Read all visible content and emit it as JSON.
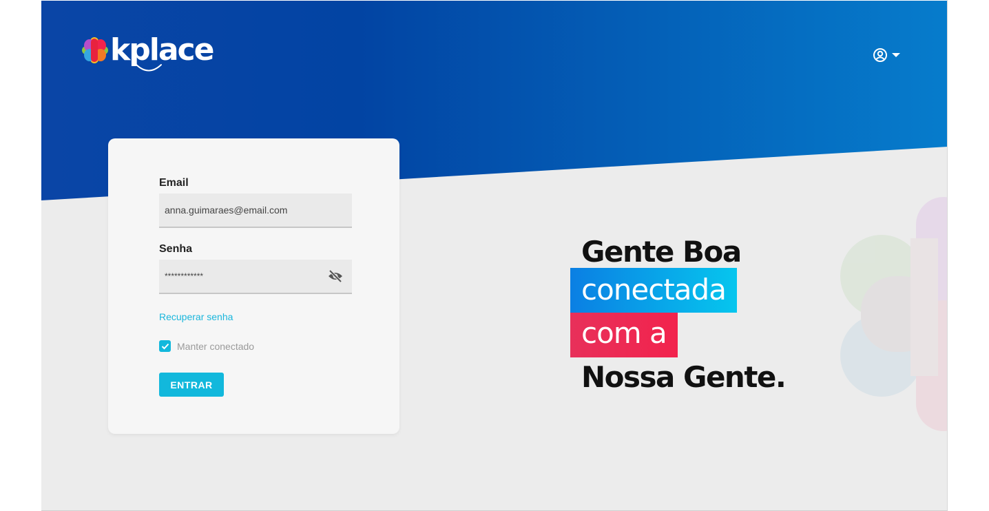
{
  "brand": {
    "name": "kplace",
    "colors": {
      "primary": "#0646a8",
      "accent": "#12b8dc",
      "pink": "#f2234d"
    }
  },
  "header": {
    "user_icon": "account-circle-icon",
    "dropdown_icon": "caret-down-icon"
  },
  "login": {
    "email_label": "Email",
    "email_value": "anna.guimaraes@email.com",
    "password_label": "Senha",
    "password_value": "************",
    "toggle_icon": "eye-off-icon",
    "forgot_link": "Recuperar senha",
    "remember_label": "Manter conectado",
    "remember_checked": true,
    "submit_label": "ENTRAR"
  },
  "slogan": {
    "line1": "Gente Boa",
    "line2": "conectada",
    "line3": "com a",
    "line4": "Nossa Gente."
  }
}
